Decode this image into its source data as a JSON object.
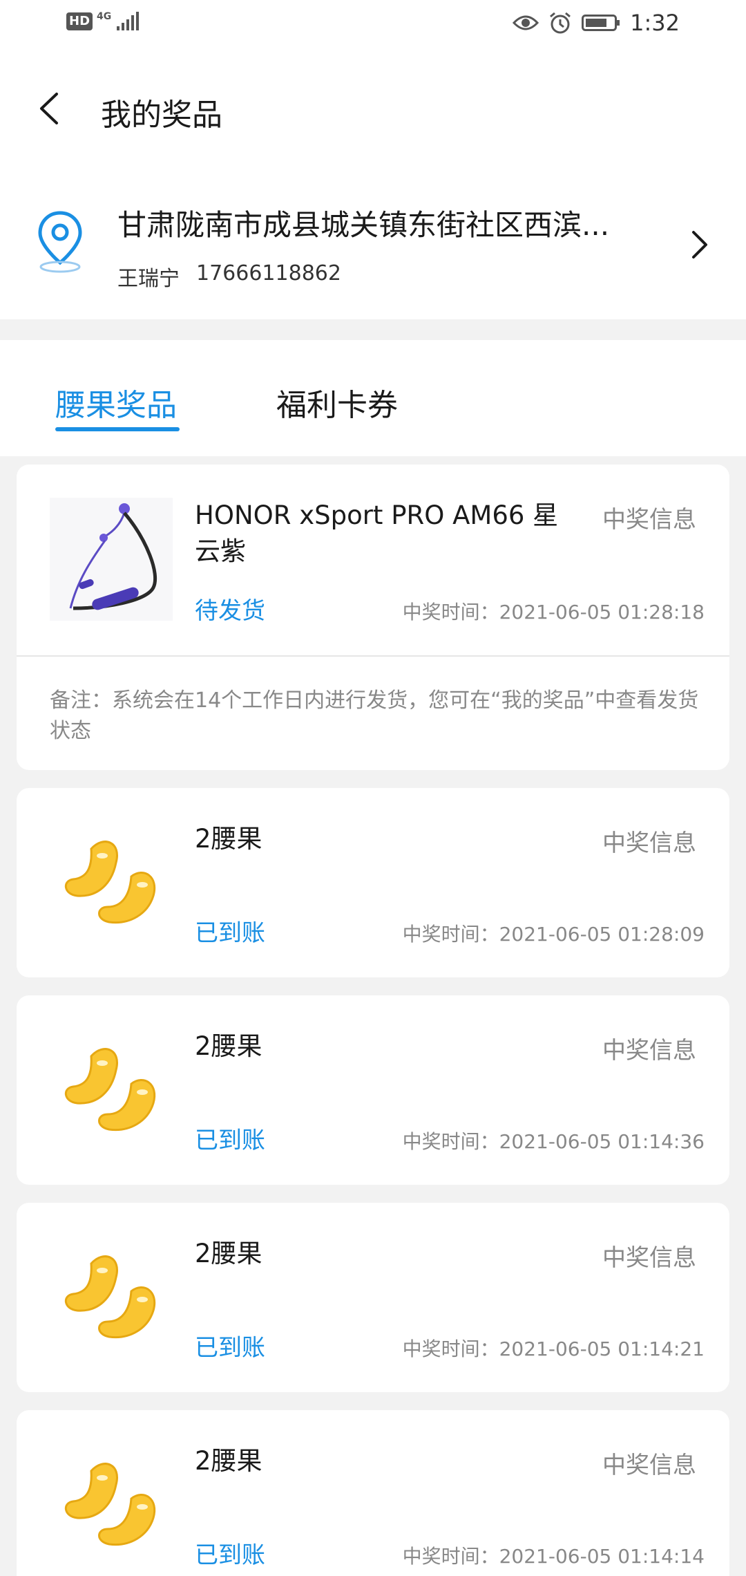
{
  "status_bar": {
    "network_badge": "HD",
    "network_type": "4G",
    "time": "1:32"
  },
  "header": {
    "title": "我的奖品"
  },
  "address": {
    "text": "甘肃陇南市成县城关镇东街社区西滨...",
    "name": "王瑞宁",
    "phone": "17666118862"
  },
  "tabs": [
    {
      "label": "腰果奖品",
      "active": true
    },
    {
      "label": "福利卡券",
      "active": false
    }
  ],
  "prizes": [
    {
      "name": "HONOR xSport PRO AM66 星云紫",
      "info_label": "中奖信息",
      "status": "待发货",
      "time": "中奖时间：2021-06-05 01:28:18",
      "note": "备注：系统会在14个工作日内进行发货，您可在“我的奖品”中查看发货状态"
    },
    {
      "name": "2腰果",
      "info_label": "中奖信息",
      "status": "已到账",
      "time": "中奖时间：2021-06-05 01:28:09"
    },
    {
      "name": "2腰果",
      "info_label": "中奖信息",
      "status": "已到账",
      "time": "中奖时间：2021-06-05 01:14:36"
    },
    {
      "name": "2腰果",
      "info_label": "中奖信息",
      "status": "已到账",
      "time": "中奖时间：2021-06-05 01:14:21"
    },
    {
      "name": "2腰果",
      "info_label": "中奖信息",
      "status": "已到账",
      "time": "中奖时间：2021-06-05 01:14:14"
    }
  ],
  "colors": {
    "accent": "#1a8fe3",
    "secondary_text": "#888888",
    "background": "#f2f2f2"
  }
}
